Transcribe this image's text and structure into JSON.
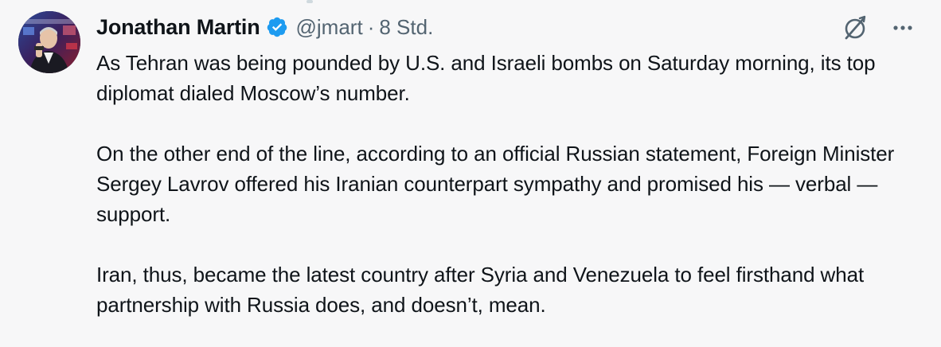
{
  "tweet": {
    "author": {
      "display_name": "Jonathan Martin",
      "handle": "@jmart",
      "verified": true
    },
    "separator": "·",
    "timestamp": "8 Std.",
    "paragraphs": [
      "As Tehran was being pounded by U.S. and Israeli bombs on Saturday morning, its top diplomat dialed Moscow’s number.",
      "On the other end of the line, according to an official Russian statement, Foreign Minister Sergey Lavrov offered his Iranian counterpart sympathy and promised his — verbal — support.",
      "Iran, thus, became the latest country after Syria and Venezuela to feel firsthand what partnership with Russia does, and doesn’t, mean."
    ]
  },
  "icons": {
    "verified": "verified-badge-icon",
    "grok": "grok-icon",
    "more": "more-icon"
  },
  "colors": {
    "background": "#f7f7f8",
    "text": "#0f1419",
    "secondary_text": "#536471",
    "verified_blue": "#1d9bf0"
  }
}
